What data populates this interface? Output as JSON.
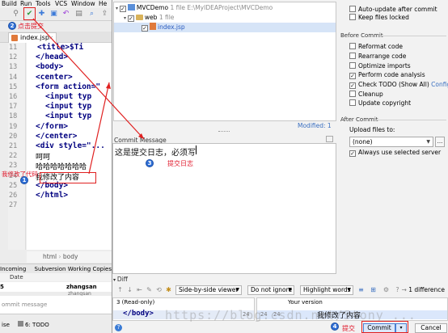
{
  "ide": {
    "menu": [
      "Build",
      "Run",
      "Tools",
      "VCS",
      "Window",
      "He"
    ],
    "tab_name": "index.jsp",
    "tab_close": "×",
    "line_numbers": [
      "11",
      "12",
      "13",
      "14",
      "15",
      "16",
      "17",
      "18",
      "19",
      "20",
      "21",
      "22",
      "23",
      "24",
      "25",
      "26",
      "27"
    ],
    "code_lines": [
      "<title>$Ti",
      "</head>",
      "<body>",
      "<center>",
      "<form action=\"",
      "<input typ",
      "<input typ",
      "<input typ",
      "</form>",
      "</center>",
      "<div style=\"...",
      "呵呵",
      "哈哈哈哈哈哈哈",
      "我修改了内容",
      "</body>",
      "</html>",
      ""
    ],
    "breadcrumb": [
      "html",
      "body"
    ],
    "vc_tabs": [
      "Incoming",
      "Subversion Working Copies"
    ],
    "vc_col_date": "Date",
    "vc_row_num": "5",
    "vc_row_author": "zhangsan",
    "vc_row_author2": "zhangsan",
    "commit_message_placeholder": "ommit message",
    "status_items": [
      "ise",
      "6: TODO"
    ]
  },
  "dialog": {
    "tree": {
      "project": "MVCDemo",
      "project_meta": "1 file  E:\\MyIDEAProject\\MVCDemo",
      "folder": "web",
      "folder_meta": "1 file",
      "file": "index.jsp"
    },
    "modified_label": "Modified: 1",
    "commit_message_label": "Commit Message",
    "commit_message_text": "这是提交日志，必须写",
    "options_top": [
      {
        "label": "Auto-update after commit",
        "checked": false
      },
      {
        "label": "Keep files locked",
        "checked": false
      }
    ],
    "before_commit_title": "Before Commit",
    "before_commit": [
      {
        "label": "Reformat code",
        "checked": false
      },
      {
        "label": "Rearrange code",
        "checked": false
      },
      {
        "label": "Optimize imports",
        "checked": false
      },
      {
        "label": "Perform code analysis",
        "checked": true
      },
      {
        "label": "Check TODO (Show All)",
        "checked": true
      },
      {
        "label": "Cleanup",
        "checked": false
      },
      {
        "label": "Update copyright",
        "checked": false
      }
    ],
    "configure_link": "Configure",
    "after_commit_title": "After Commit",
    "upload_label": "Upload files to:",
    "upload_value": "(none)",
    "upload_more": "...",
    "always_selected_server": {
      "label": "Always use selected server",
      "checked": true
    },
    "diff": {
      "title": "Diff",
      "viewer": "Side-by-side viewer",
      "ignore": "Do not ignore",
      "highlight": "Highlight words",
      "difference_count": "1 difference",
      "left_caption": "3 (Read-only)",
      "right_caption": "Your version",
      "left_line": "</body>",
      "left_num": "24",
      "right_num_a": "24",
      "right_num_b": "24",
      "right_line": "我修改了内容",
      "watermark": "https://blog.csdn.net/Stony_..."
    },
    "help": "?",
    "commit_button": "Commit",
    "commit_split": "▾",
    "cancel_button": "Cancel"
  },
  "annotations": {
    "step1_label": "我修改了代码",
    "step2_label": "点击提交",
    "step3_label": "提交日志",
    "step4_label": "提交",
    "badges": [
      "1",
      "2",
      "3",
      "4"
    ]
  },
  "colors": {
    "annotation_red": "#e0182b",
    "badge_blue": "#2f6fd6",
    "link_blue": "#3a6fc0",
    "selection": "#d6e4f7"
  }
}
